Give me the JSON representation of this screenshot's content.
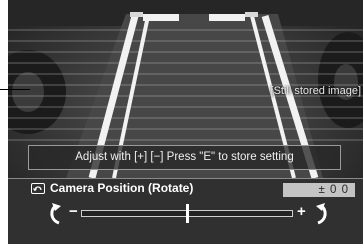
{
  "overlay": {
    "stored_label": "[Still stored image]",
    "hint": "Adjust with [+] [−]    Press \"E\" to store setting"
  },
  "panel": {
    "icon": "camera-rotate-icon",
    "title": "Camera Position (Rotate)",
    "value": "±  0 0",
    "minus": "−",
    "plus": "+",
    "rotate_left_icon": "rotate-counterclockwise-icon",
    "rotate_right_icon": "rotate-clockwise-icon",
    "slider_level": 0.5
  },
  "colors": {
    "background": "#3a3a3a",
    "guide_lines": "#f2f2f2",
    "panel": "#303030",
    "value_box": "#c4c4c4"
  }
}
